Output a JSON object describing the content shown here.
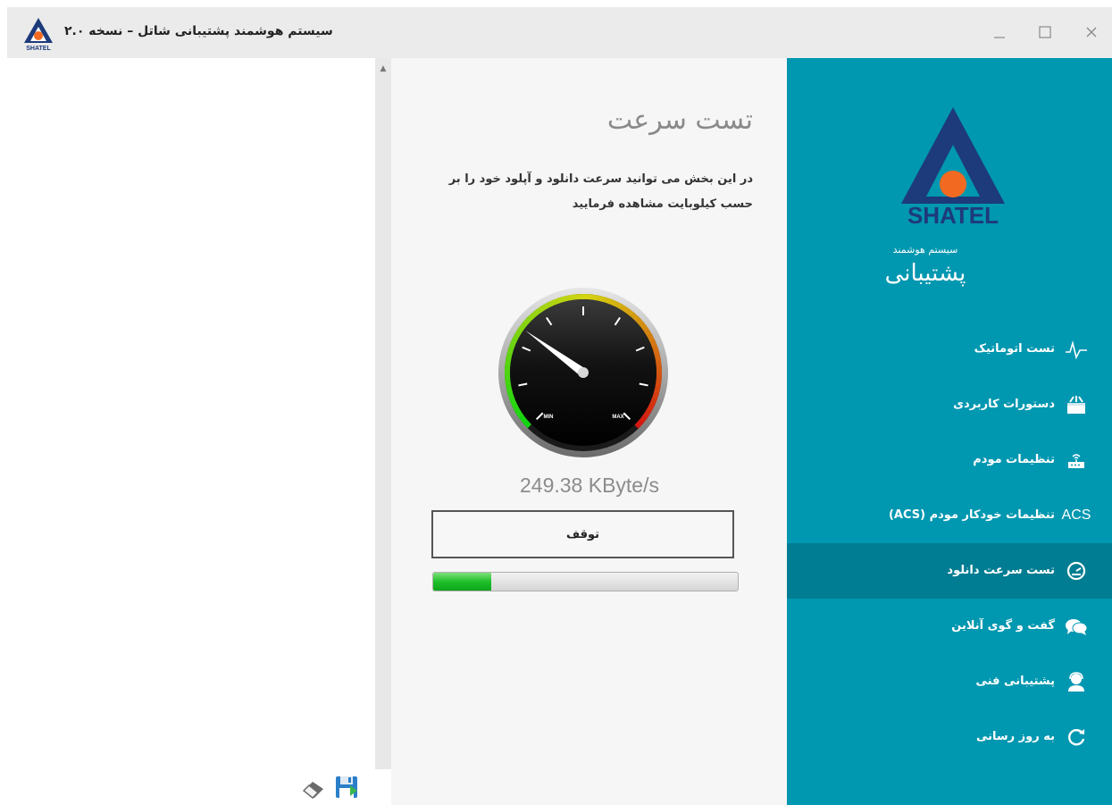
{
  "window": {
    "title": "سیستم هوشمند پشتیبانی شاتل – نسخه ۲.۰",
    "logo_label": "SHATEL"
  },
  "content": {
    "title": "تست سرعت",
    "description": "در این بخش می توانید سرعت دانلود و آپلود خود را بر حسب کیلوبایت مشاهده فرمایید",
    "gauge": {
      "min_label": "MIN",
      "max_label": "MAX",
      "needle_fraction": 0.3
    },
    "speed": "249.38 KByte/s",
    "stop_label": "توقف",
    "progress_fraction": 0.19
  },
  "brand": {
    "name": "SHATEL",
    "subtitle": "سیستم هوشمند",
    "title": "پشتیبانی"
  },
  "nav": [
    {
      "label": "تست اتوماتیک",
      "icon": "pulse-icon",
      "active": false
    },
    {
      "label": "دستورات کاربردی",
      "icon": "toolbox-icon",
      "active": false
    },
    {
      "label": "تنظیمات مودم",
      "icon": "router-icon",
      "active": false
    },
    {
      "label": "تنظیمات خودکار مودم (ACS)",
      "icon": "acs-icon",
      "icon_text": "ACS",
      "active": false
    },
    {
      "label": "تست سرعت دانلود",
      "icon": "speedometer-icon",
      "active": true
    },
    {
      "label": "گفت و گوی آنلاین",
      "icon": "chat-icon",
      "active": false
    },
    {
      "label": "پشتیبانی فنی",
      "icon": "support-agent-icon",
      "active": false
    },
    {
      "label": "به روز رسانی",
      "icon": "refresh-icon",
      "active": false
    }
  ],
  "colors": {
    "sidebar": "#0097b0",
    "sidebar_active": "#007d92",
    "brand_blue": "#1d3a7a",
    "brand_orange": "#f26a21",
    "progress_green": "#1fbf2a"
  }
}
